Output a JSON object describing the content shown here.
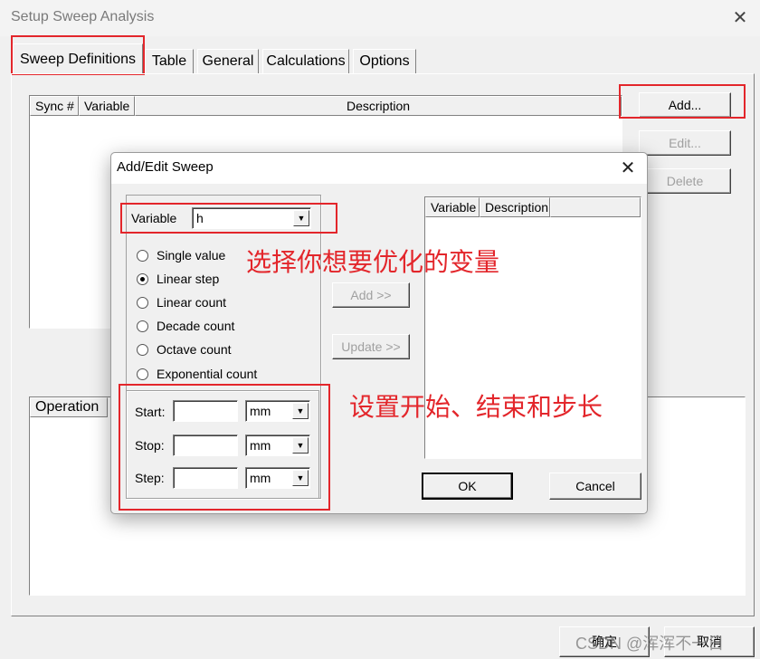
{
  "window": {
    "title": "Setup Sweep Analysis",
    "close_glyph": "✕"
  },
  "tabs": [
    {
      "label": "Sweep Definitions"
    },
    {
      "label": "Table"
    },
    {
      "label": "General"
    },
    {
      "label": "Calculations"
    },
    {
      "label": "Options"
    }
  ],
  "sweep_table": {
    "columns": [
      "Sync #",
      "Variable",
      "Description"
    ]
  },
  "side_buttons": {
    "add": "Add...",
    "edit": "Edit...",
    "delete": "Delete"
  },
  "operation_table": {
    "columns": [
      "Operation"
    ]
  },
  "bottom_buttons": {
    "ok": "确定",
    "cancel": "取消"
  },
  "watermark": "CSDN @浑浑不一日",
  "dialog": {
    "title": "Add/Edit Sweep",
    "close_glyph": "✕",
    "variable_label": "Variable",
    "variable_value": "h",
    "sweep_types": [
      {
        "label": "Single value",
        "selected": false
      },
      {
        "label": "Linear step",
        "selected": true
      },
      {
        "label": "Linear count",
        "selected": false
      },
      {
        "label": "Decade count",
        "selected": false
      },
      {
        "label": "Octave count",
        "selected": false
      },
      {
        "label": "Exponential count",
        "selected": false
      }
    ],
    "range": [
      {
        "label": "Start:",
        "value": "",
        "unit": "mm"
      },
      {
        "label": "Stop:",
        "value": "",
        "unit": "mm"
      },
      {
        "label": "Step:",
        "value": "",
        "unit": "mm"
      }
    ],
    "add_button": "Add >>",
    "update_button": "Update >>",
    "list_columns": [
      "Variable",
      "Description"
    ],
    "ok": "OK",
    "cancel": "Cancel"
  },
  "annotations": {
    "choose_variable": "选择你想要优化的变量",
    "set_range": "设置开始、结束和步长"
  },
  "highlight_color": "#e3262b"
}
